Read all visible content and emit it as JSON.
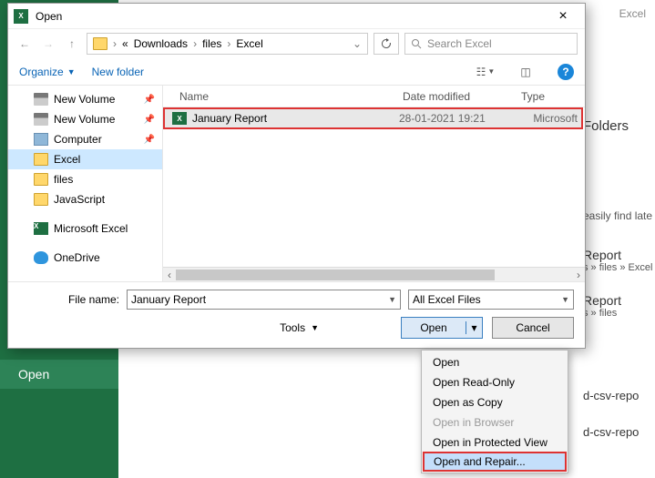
{
  "bg": {
    "excel_label": "Excel",
    "open_label": "Open",
    "folders_heading": "Folders",
    "easy_text": "easily find late",
    "report_heading": "Report",
    "report_path1": "s » files » Excel",
    "report_path2": "s » files",
    "csv_rep": "d-csv-repo"
  },
  "dialog": {
    "title": "Open",
    "breadcrumbs": [
      "Downloads",
      "files",
      "Excel"
    ],
    "search_placeholder": "Search Excel",
    "organize": "Organize",
    "new_folder": "New folder",
    "tree": [
      {
        "label": "New Volume",
        "icon": "drive",
        "pinned": true
      },
      {
        "label": "New Volume",
        "icon": "drive",
        "pinned": true
      },
      {
        "label": "Computer",
        "icon": "pc",
        "pinned": true
      },
      {
        "label": "Excel",
        "icon": "folder",
        "selected": true
      },
      {
        "label": "files",
        "icon": "folder"
      },
      {
        "label": "JavaScript",
        "icon": "folder"
      },
      {
        "label": "Microsoft Excel",
        "icon": "xl",
        "gap": true
      },
      {
        "label": "OneDrive",
        "icon": "onedrive",
        "gap": true
      }
    ],
    "columns": {
      "name": "Name",
      "date": "Date modified",
      "type": "Type"
    },
    "file": {
      "name": "January Report",
      "date": "28-01-2021 19:21",
      "type": "Microsoft"
    },
    "filename_label": "File name:",
    "filename_value": "January Report",
    "filter": "All Excel Files",
    "tools": "Tools",
    "open_btn": "Open",
    "cancel_btn": "Cancel"
  },
  "menu": {
    "items": [
      {
        "label": "Open"
      },
      {
        "label": "Open Read-Only"
      },
      {
        "label": "Open as Copy"
      },
      {
        "label": "Open in Browser",
        "disabled": true
      },
      {
        "label": "Open in Protected View"
      },
      {
        "label": "Open and Repair...",
        "highlight": true
      }
    ]
  }
}
